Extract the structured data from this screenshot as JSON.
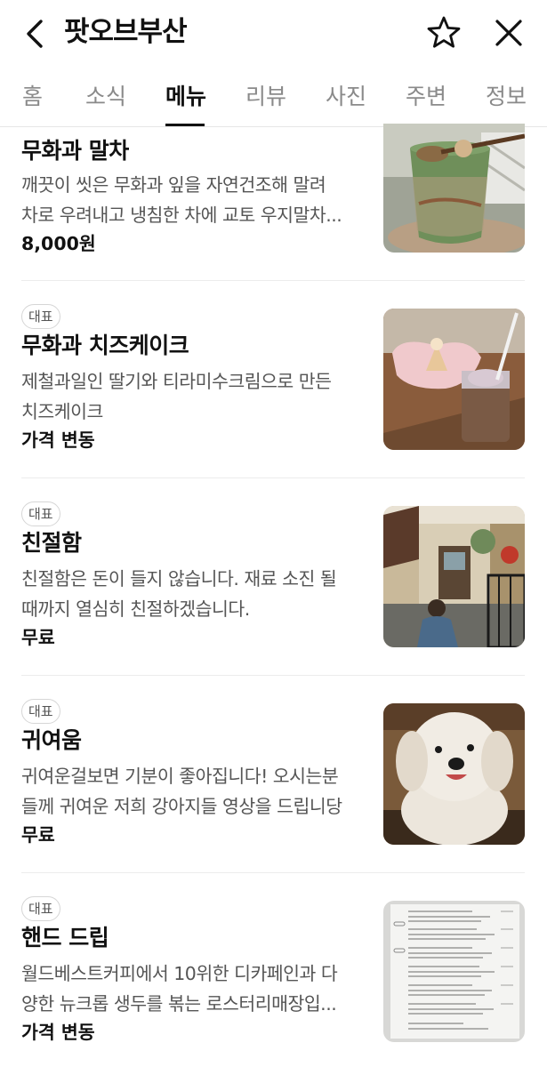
{
  "header": {
    "title": "팟오브부산",
    "back_icon": "chevron-left-icon",
    "favorite_icon": "star-outline-icon",
    "close_icon": "close-icon"
  },
  "tabs": [
    {
      "label": "홈"
    },
    {
      "label": "소식"
    },
    {
      "label": "메뉴",
      "active": true
    },
    {
      "label": "리뷰"
    },
    {
      "label": "사진"
    },
    {
      "label": "주변"
    },
    {
      "label": "정보"
    }
  ],
  "menu": {
    "items": [
      {
        "badge": "",
        "name": "무화과 말차",
        "desc_line1": "깨끗이 씻은 무화과 잎을 자연건조해 말려",
        "desc_line2": "차로 우려내고 냉침한 차에 교토 우지말차...",
        "price": "8,000원"
      },
      {
        "badge": "대표",
        "name": "무화과 치즈케이크",
        "desc_line1": "제철과일인 딸기와 티라미수크림으로 만든",
        "desc_line2": "치즈케이크",
        "price": "가격 변동"
      },
      {
        "badge": "대표",
        "name": "친절함",
        "desc_line1": "친절함은 돈이 들지 않습니다. 재료 소진 될",
        "desc_line2": "때까지 열심히 친절하겠습니다.",
        "price": "무료"
      },
      {
        "badge": "대표",
        "name": "귀여움",
        "desc_line1": "귀여운걸보면 기분이 좋아집니다! 오시는분",
        "desc_line2": "들께 귀여운 저희 강아지들 영상을 드립니당",
        "price": "무료"
      },
      {
        "badge": "대표",
        "name": "핸드 드립",
        "desc_line1": "월드베스트커피에서 10위한 디카페인과 다",
        "desc_line2": "양한 뉴크롭 생두를 볶는 로스터리매장입...",
        "price": "가격 변동"
      }
    ]
  },
  "colors": {
    "text_primary": "#111111",
    "text_secondary": "#555555",
    "tab_inactive": "#8a8a8a",
    "divider": "#ececec"
  }
}
